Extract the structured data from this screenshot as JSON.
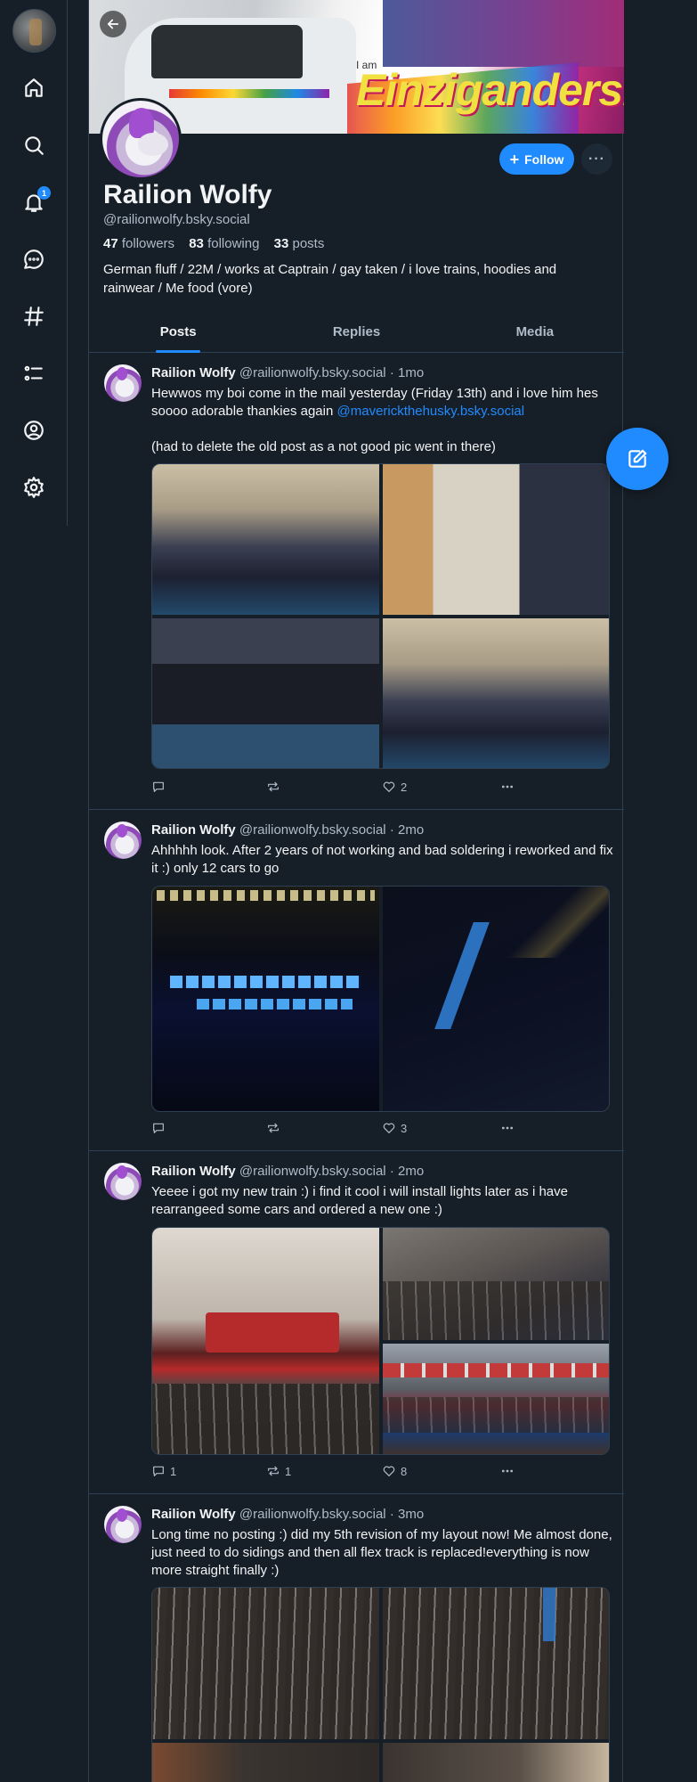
{
  "nav": {
    "items": [
      {
        "name": "home-icon"
      },
      {
        "name": "search-icon"
      },
      {
        "name": "bell-icon",
        "badge": "1"
      },
      {
        "name": "chat-icon"
      },
      {
        "name": "hashtag-icon"
      },
      {
        "name": "list-icon"
      },
      {
        "name": "profile-icon"
      },
      {
        "name": "settings-icon"
      }
    ]
  },
  "banner": {
    "brand_small": "I am",
    "brand_word": "Einziganders."
  },
  "profile": {
    "display_name": "Railion Wolfy",
    "handle": "@railionwolfy.bsky.social",
    "followers_count": "47",
    "followers_label": "followers",
    "following_count": "83",
    "following_label": "following",
    "posts_count": "33",
    "posts_label": "posts",
    "bio": "German fluff / 22M / works at Captrain / gay taken / i love trains, hoodies and rainwear / Me food (vore)",
    "follow_label": "Follow",
    "more_label": "···"
  },
  "tabs": [
    {
      "label": "Posts",
      "active": true
    },
    {
      "label": "Replies",
      "active": false
    },
    {
      "label": "Media",
      "active": false
    }
  ],
  "posts": [
    {
      "author": "Railion Wolfy",
      "handle": "@railionwolfy.bsky.social",
      "time": "· 1mo",
      "text_before": "Hewwos my boi come in the mail yesterday (Friday 13th) and i love him hes soooo adorable thankies again ",
      "mention": "@maverickthehusky.bsky.social",
      "text_after": "(had to delete the old post as a not good pic went in there)",
      "replies": "",
      "reposts": "",
      "likes": "2"
    },
    {
      "author": "Railion Wolfy",
      "handle": "@railionwolfy.bsky.social",
      "time": "· 2mo",
      "text": "Ahhhhh look. After 2 years of not working and bad soldering i reworked and fix it :) only 12 cars to go",
      "replies": "",
      "reposts": "",
      "likes": "3"
    },
    {
      "author": "Railion Wolfy",
      "handle": "@railionwolfy.bsky.social",
      "time": "· 2mo",
      "text": "Yeeee i got my new train :) i find it cool i will install lights later as i have rearrangeed some cars and ordered a new one :)",
      "replies": "1",
      "reposts": "1",
      "likes": "8"
    },
    {
      "author": "Railion Wolfy",
      "handle": "@railionwolfy.bsky.social",
      "time": "· 3mo",
      "text": "Long time no posting :) did my 5th revision of my layout now! Me almost done, just need to do sidings and then all flex track is replaced!everything is now more straight finally :)",
      "replies": "",
      "reposts": "",
      "likes": ""
    }
  ]
}
